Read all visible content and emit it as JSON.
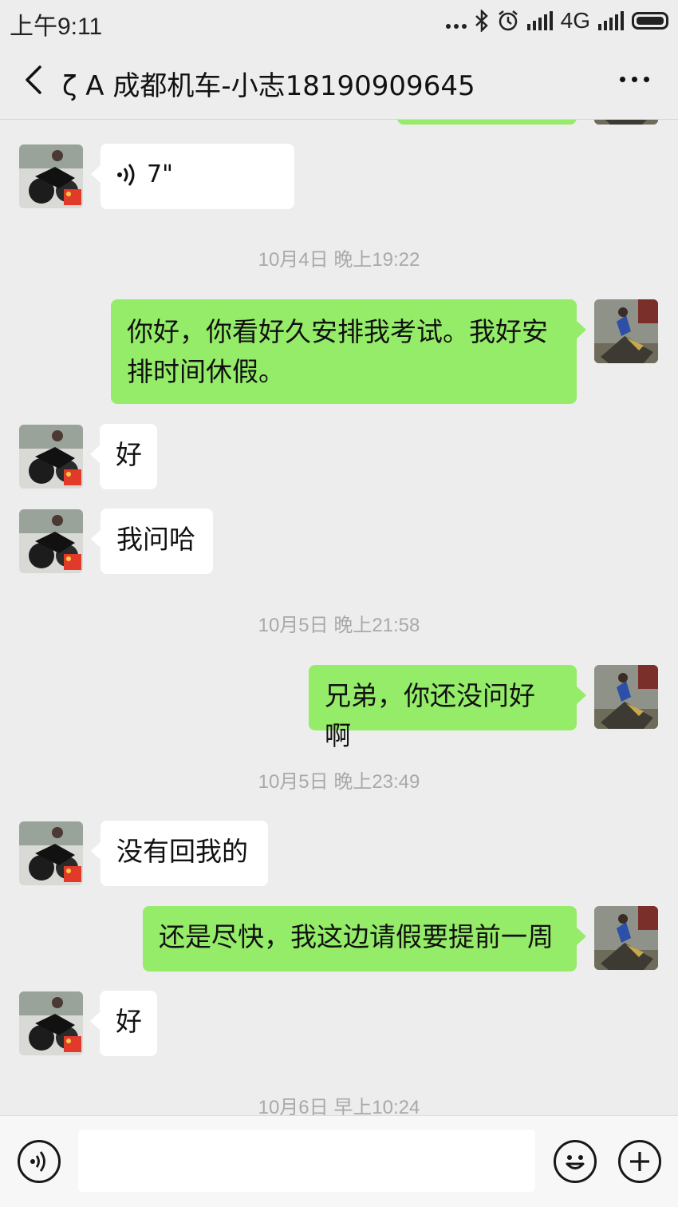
{
  "status_bar": {
    "time": "上午9:11",
    "network": "4G"
  },
  "header": {
    "title": "ζ  A 成都机车-小志18190909645"
  },
  "colors": {
    "outgoing_bubble": "#95ec69",
    "incoming_bubble": "#ffffff",
    "background": "#ededed"
  },
  "messages": [
    {
      "type": "voice",
      "direction": "in",
      "duration": "7\""
    },
    {
      "type": "timestamp",
      "text": "10月4日 晚上19:22"
    },
    {
      "type": "text",
      "direction": "out",
      "line1": "你好，你看好久安排我考试。我好安",
      "line2": "排时间休假。"
    },
    {
      "type": "text",
      "direction": "in",
      "text": "好"
    },
    {
      "type": "text",
      "direction": "in",
      "text": "我问哈"
    },
    {
      "type": "timestamp",
      "text": "10月5日 晚上21:58"
    },
    {
      "type": "text",
      "direction": "out",
      "text": "兄弟，你还没问好啊"
    },
    {
      "type": "timestamp",
      "text": "10月5日 晚上23:49"
    },
    {
      "type": "text",
      "direction": "in",
      "text": "没有回我的"
    },
    {
      "type": "text",
      "direction": "out",
      "text": "还是尽快，我这边请假要提前一周"
    },
    {
      "type": "text",
      "direction": "in",
      "text": "好"
    },
    {
      "type": "timestamp",
      "text": "10月6日 早上10:24"
    }
  ],
  "icons": {
    "back": "chevron-left-icon",
    "more": "more-dots-icon",
    "voice_input": "voice-icon",
    "emoji": "emoji-icon",
    "add": "plus-icon"
  }
}
